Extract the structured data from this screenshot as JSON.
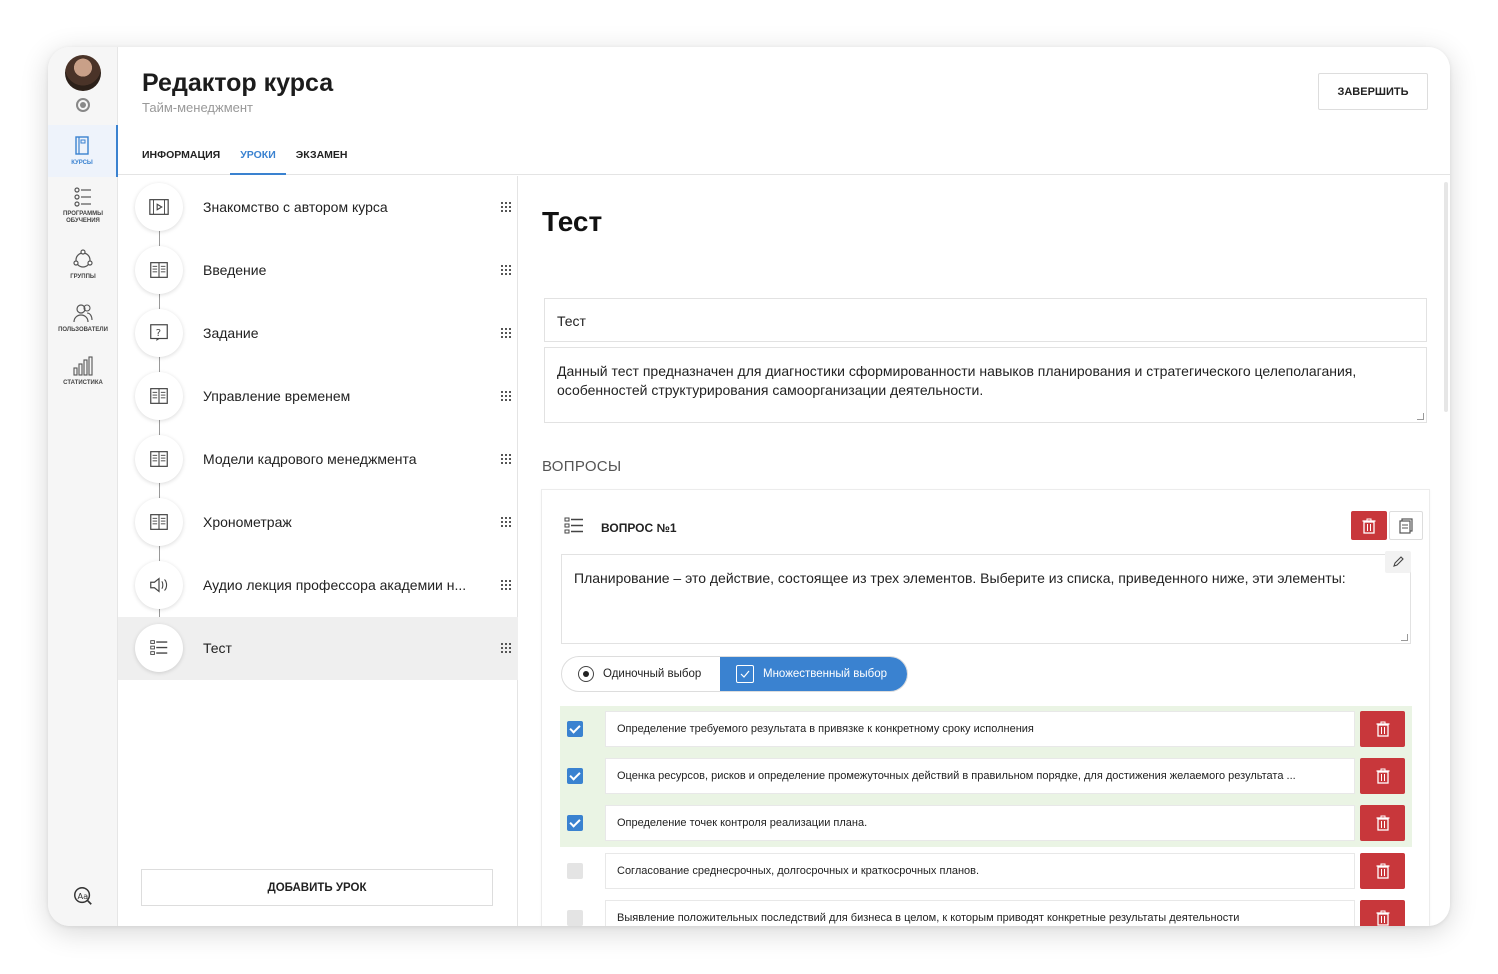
{
  "app": {
    "title": "Редактор курса",
    "subtitle": "Тайм-менеджмент",
    "finish_label": "ЗАВЕРШИТЬ"
  },
  "rail": {
    "items": [
      {
        "label": "КУРСЫ",
        "icon": "book-icon",
        "active": true
      },
      {
        "label": "ПРОГРАММЫ ОБУЧЕНИЯ",
        "icon": "checklist-icon",
        "active": false
      },
      {
        "label": "ГРУППЫ",
        "icon": "group-icon",
        "active": false
      },
      {
        "label": "ПОЛЬЗОВАТЕЛИ",
        "icon": "users-icon",
        "active": false
      },
      {
        "label": "СТАТИСТИКА",
        "icon": "bar-chart-icon",
        "active": false
      }
    ]
  },
  "tabs": [
    {
      "label": "ИНФОРМАЦИЯ",
      "active": false
    },
    {
      "label": "УРОКИ",
      "active": true
    },
    {
      "label": "ЭКЗАМЕН",
      "active": false
    }
  ],
  "lessons": [
    {
      "label": "Знакомство с автором курса",
      "icon": "video-icon"
    },
    {
      "label": "Введение",
      "icon": "open-book-icon"
    },
    {
      "label": "Задание",
      "icon": "question-icon"
    },
    {
      "label": "Управление временем",
      "icon": "open-book-icon"
    },
    {
      "label": "Модели кадрового менеджмента",
      "icon": "open-book-icon"
    },
    {
      "label": "Хронометраж",
      "icon": "open-book-icon"
    },
    {
      "label": "Аудио лекция профессора академии н...",
      "icon": "speaker-icon"
    },
    {
      "label": "Тест",
      "icon": "test-list-icon",
      "selected": true
    }
  ],
  "add_lesson_label": "ДОБАВИТЬ УРОК",
  "editor": {
    "title": "Тест",
    "name_value": "Тест",
    "description_value": "Данный тест предназначен для диагностики сформированности навыков планирования и стратегического целеполагания, особенностей структурирования самоорганизации деятельности.",
    "questions_heading": "ВОПРОСЫ",
    "question": {
      "heading": "ВОПРОС №1",
      "text": "Планирование – это действие, состоящее из трех элементов. Выберите из списка, приведенного ниже, эти элементы:",
      "mode_single": "Одиночный выбор",
      "mode_multi": "Множественный выбор",
      "answers": [
        {
          "text": "Определение требуемого результата в привязке к конкретному сроку исполнения",
          "correct": true
        },
        {
          "text": "Оценка ресурсов, рисков и определение промежуточных действий в правильном порядке, для достижения желаемого результата ...",
          "correct": true
        },
        {
          "text": "Определение точек контроля реализации плана.",
          "correct": true
        },
        {
          "text": "Согласование среднесрочных, долгосрочных и краткосрочных планов.",
          "correct": false
        },
        {
          "text": "Выявление положительных последствий для бизнеса в целом, к которым приводят конкретные результаты деятельности",
          "correct": false
        }
      ]
    }
  },
  "colors": {
    "accent": "#3a82d0",
    "danger": "#c8373b",
    "correct_bg": "#eaf4e4"
  }
}
